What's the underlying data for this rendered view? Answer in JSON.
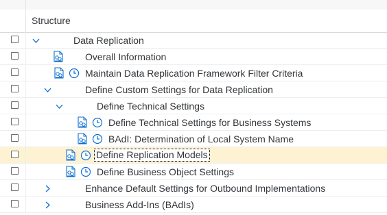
{
  "header": {
    "title": "Structure"
  },
  "rows": [
    {
      "label": "Data Replication",
      "expander": "expanded",
      "icons": []
    },
    {
      "label": "Overall Information",
      "expander": "none",
      "icons": [
        "document-icon"
      ]
    },
    {
      "label": "Maintain Data Replication Framework Filter Criteria",
      "expander": "none",
      "icons": [
        "document-icon",
        "clock-icon"
      ]
    },
    {
      "label": "Define Custom Settings for Data Replication",
      "expander": "expanded",
      "icons": []
    },
    {
      "label": "Define Technical Settings",
      "expander": "expanded",
      "icons": []
    },
    {
      "label": "Define Technical Settings for Business Systems",
      "expander": "none",
      "icons": [
        "document-icon",
        "clock-icon"
      ]
    },
    {
      "label": "BAdI: Determination of Local System Name",
      "expander": "none",
      "icons": [
        "document-icon",
        "clock-icon"
      ]
    },
    {
      "label": "Define Replication Models",
      "expander": "none",
      "icons": [
        "document-icon",
        "clock-icon"
      ],
      "selected": true
    },
    {
      "label": "Define Business Object Settings",
      "expander": "none",
      "icons": [
        "document-icon",
        "clock-icon"
      ]
    },
    {
      "label": "Enhance Default Settings for Outbound Implementations",
      "expander": "collapsed",
      "icons": []
    },
    {
      "label": "Business Add-Ins (BAdIs)",
      "expander": "collapsed",
      "icons": []
    }
  ],
  "colors": {
    "selected_row": "#fdf3d3",
    "icon_blue": "#0a6ed1",
    "text": "#32363a"
  }
}
